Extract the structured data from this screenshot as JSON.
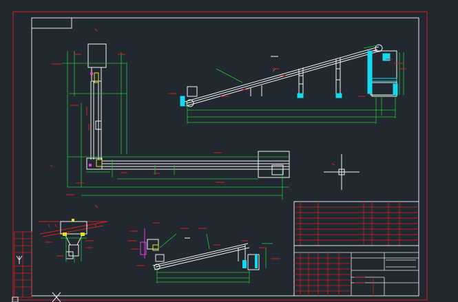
{
  "drawing": {
    "background": "#212830",
    "colors": {
      "border": "#d42020",
      "frame": "#e8e8e8",
      "dimension": "#22c53a",
      "structure": "#f2f2f2",
      "accent_cyan": "#16d8ee",
      "accent_magenta": "#e03cdc",
      "accent_yellow": "#e6e020",
      "table_lines": "#d42020"
    },
    "views": [
      "plan-view",
      "inclined-conveyor-elevation",
      "hopper-section",
      "lower-conveyor-elevation",
      "title-block"
    ],
    "icons": [
      "ucs-y-axis-icon",
      "cursor-crosshair-icon"
    ]
  }
}
